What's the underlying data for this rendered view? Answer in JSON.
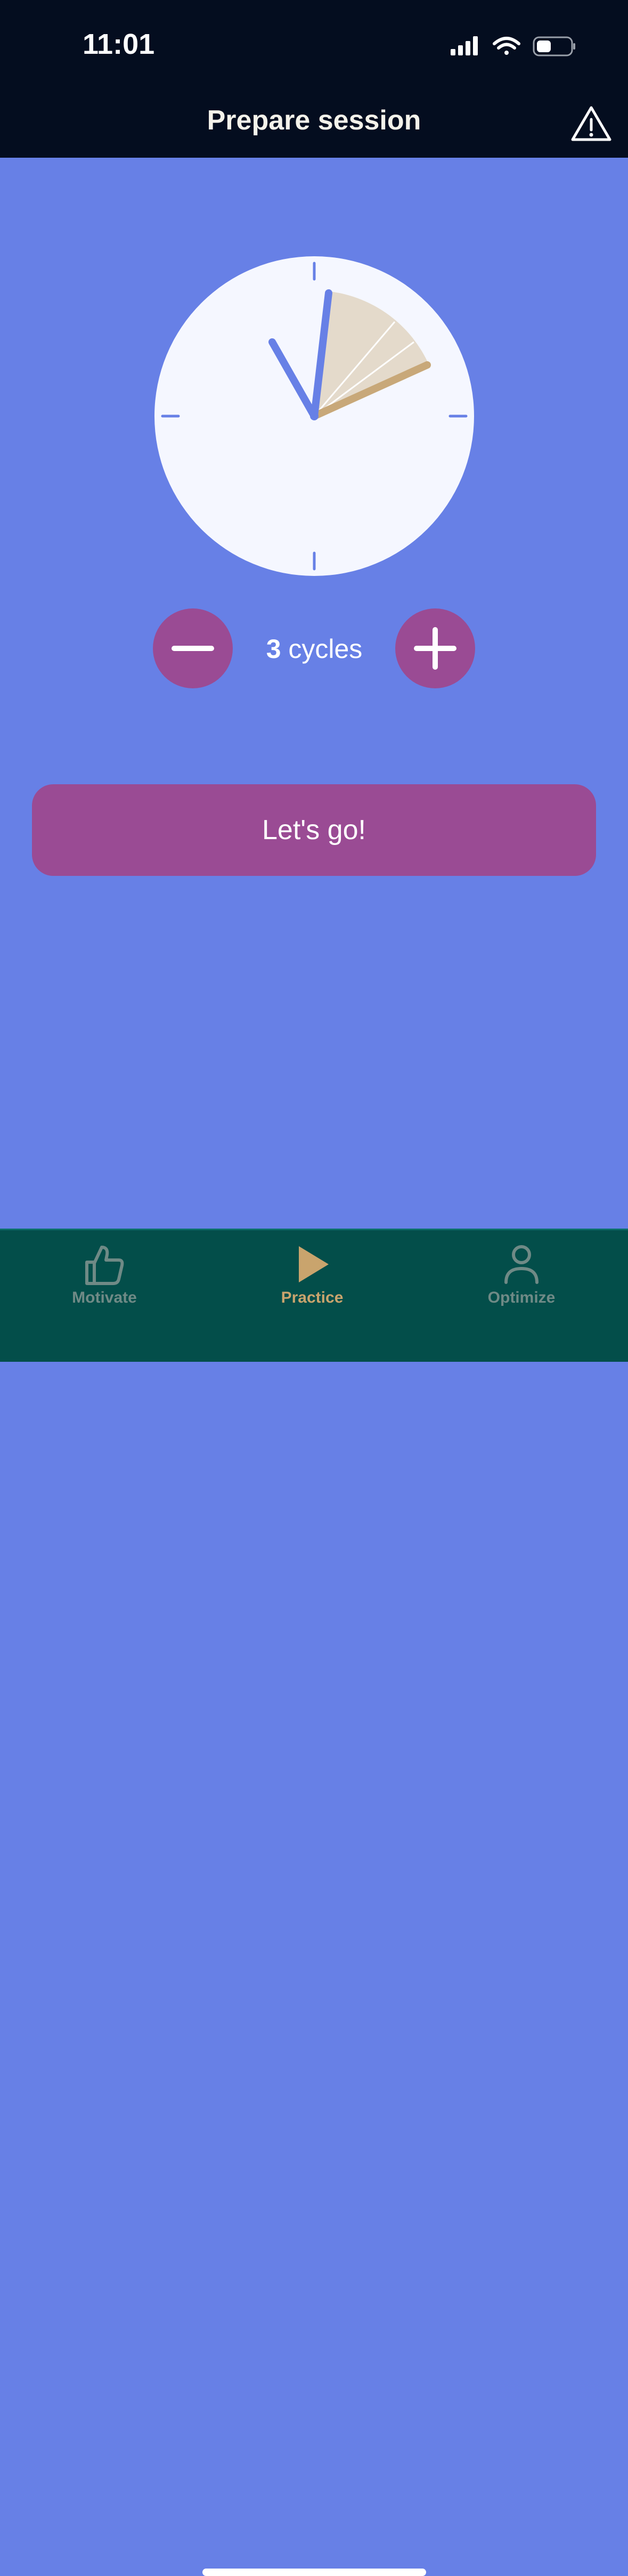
{
  "status_bar": {
    "time": "11:01",
    "icons": [
      "cellular-signal-icon",
      "wifi-icon",
      "battery-icon"
    ]
  },
  "header": {
    "title": "Prepare session",
    "alert_icon": "warning-triangle-icon"
  },
  "clock": {
    "hour_hand_time": "11:01",
    "session_cycles_shown": 3
  },
  "stepper": {
    "count": "3",
    "unit": " cycles",
    "minus_icon": "minus-icon",
    "plus_icon": "plus-icon"
  },
  "action": {
    "go_label": "Let's go!"
  },
  "tabs": [
    {
      "label": "Motivate",
      "icon": "thumbs-up-icon",
      "active": false
    },
    {
      "label": "Practice",
      "icon": "play-icon",
      "active": true
    },
    {
      "label": "Optimize",
      "icon": "person-icon",
      "active": false
    }
  ],
  "colors": {
    "background": "#6780e6",
    "header": "#040d1f",
    "accent_purple": "#9a4b94",
    "tabbar": "#034e4a",
    "active_tab": "#c9a46d",
    "inactive_tab": "#6f8a86",
    "clock_face": "#f5f7ff",
    "session_wedge": "#e4dacb"
  }
}
